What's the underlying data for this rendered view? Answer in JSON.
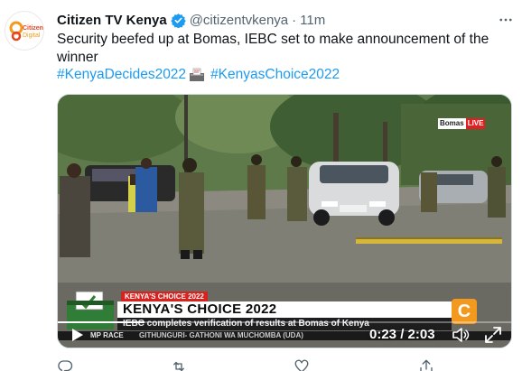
{
  "tweet": {
    "display_name": "Citizen TV Kenya",
    "handle": "@citizentvkenya",
    "separator": "·",
    "time": "11m",
    "text": "Security beefed up at Bomas, IEBC set to make announcement of the winner",
    "hashtags": [
      "#KenyaDecides2022",
      "#KenyasChoice2022"
    ],
    "avatar_text": [
      "Citizen",
      "Digital"
    ],
    "more_icon": "more-horizontal-icon",
    "verified_color": "#1d9bf0"
  },
  "video": {
    "live_badge": [
      "Bomas",
      "LIVE"
    ],
    "lower_third_tag": "KENYA'S CHOICE 2022",
    "lower_third_title": "KENYA'S CHOICE 2022",
    "lower_third_subtitle": "IEBC completes verification of results at Bomas of Kenya",
    "ticker_left": "MP RACE",
    "ticker_text": "GITHUNGURI- GATHONI WA MUCHOMBA (UDA)",
    "elapsed": "0:23",
    "duration": "2:03",
    "time_readout": "0:23 / 2:03",
    "progress_fraction": 0.19
  },
  "actions": {
    "icons": [
      "reply-icon",
      "retweet-icon",
      "like-icon",
      "share-icon"
    ]
  },
  "colors": {
    "link": "#1d9bf0",
    "secondary_text": "#536471",
    "citizen_orange": "#f39a1e",
    "live_red": "#e02020"
  }
}
